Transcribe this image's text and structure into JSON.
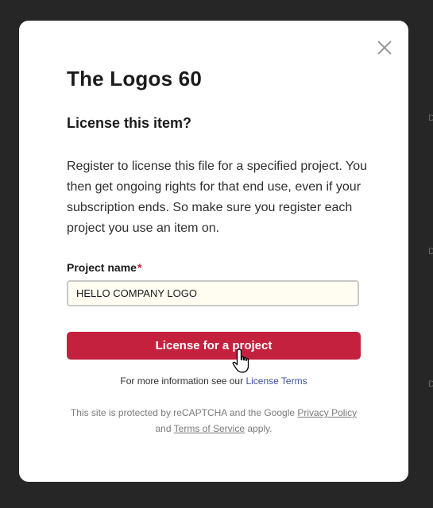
{
  "modal": {
    "title": "The Logos 60",
    "subtitle": "License this item?",
    "description": "Register to license this file for a specified project. You then get ongoing rights for that end use, even if your subscription ends. So make sure you register each project you use an item on.",
    "close_icon": "close-icon",
    "form": {
      "label": "Project name",
      "required_mark": "*",
      "value": "HELLO COMPANY LOGO"
    },
    "submit_label": "License for a project",
    "info_text": "For more information see our",
    "info_link": "License Terms",
    "recaptcha": {
      "prefix": "This site is protected by reCAPTCHA and the Google",
      "privacy_link": "Privacy Policy",
      "and": "and",
      "terms_link": "Terms of Service",
      "suffix": "apply."
    }
  },
  "background": {
    "edge_glyph": "D"
  },
  "colors": {
    "accent": "#c4213f",
    "link": "#3a4fa3",
    "backdrop": "#262626"
  }
}
